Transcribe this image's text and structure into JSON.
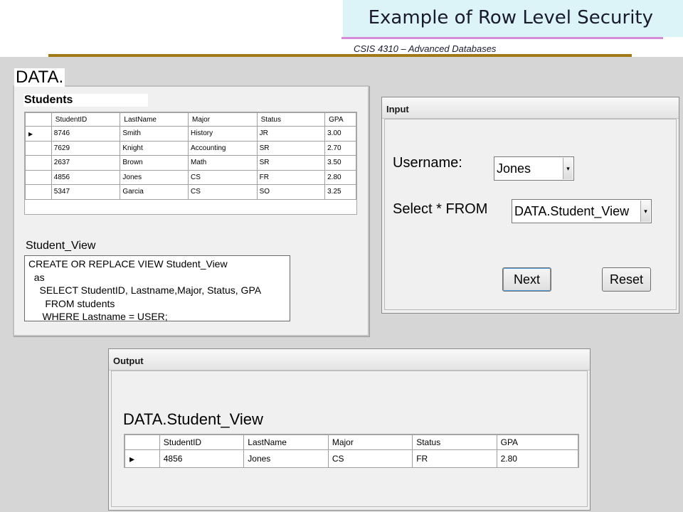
{
  "slide": {
    "title": "Example of Row Level Security",
    "course": "CSIS 4310 – Advanced Databases"
  },
  "data_panel": {
    "label": "DATA.",
    "students_label": "Students",
    "students_table": {
      "columns": [
        "StudentID",
        "LastName",
        "Major",
        "Status",
        "GPA"
      ],
      "rows": [
        [
          "8746",
          "Smith",
          "History",
          "JR",
          "3.00"
        ],
        [
          "7629",
          "Knight",
          "Accounting",
          "SR",
          "2.70"
        ],
        [
          "2637",
          "Brown",
          "Math",
          "SR",
          "3.50"
        ],
        [
          "4856",
          "Jones",
          "CS",
          "FR",
          "2.80"
        ],
        [
          "5347",
          "Garcia",
          "CS",
          "SO",
          "3.25"
        ]
      ],
      "current_row_marker": "▸"
    },
    "view_label": "Student_View",
    "view_sql": [
      "CREATE OR REPLACE VIEW Student_View",
      "  as",
      "    SELECT StudentID, Lastname,Major, Status, GPA",
      "      FROM students",
      "     WHERE Lastname = USER;"
    ]
  },
  "input_window": {
    "title": "Input",
    "username_label": "Username:",
    "username_value": "Jones",
    "select_label": "Select * FROM",
    "select_value": "DATA.Student_View",
    "dropdown_arrow": "▾",
    "next_label": "Next",
    "reset_label": "Reset"
  },
  "output_window": {
    "title": "Output",
    "view_name": "DATA.Student_View",
    "table": {
      "columns": [
        "StudentID",
        "LastName",
        "Major",
        "Status",
        "GPA"
      ],
      "rows": [
        [
          "4856",
          "Jones",
          "CS",
          "FR",
          "2.80"
        ]
      ],
      "current_row_marker": "▸"
    }
  }
}
